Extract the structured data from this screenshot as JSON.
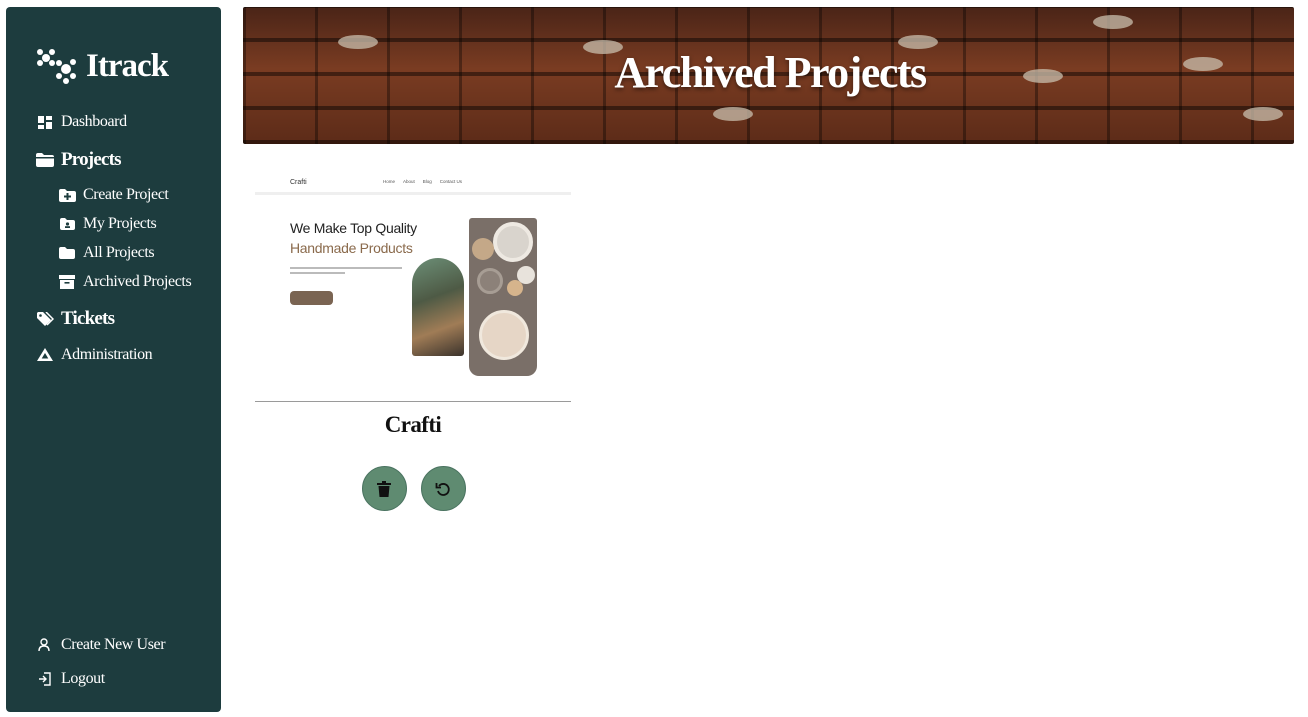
{
  "app": {
    "name": "Itrack"
  },
  "sidebar": {
    "items": [
      {
        "label": "Dashboard",
        "icon": "dashboard-icon"
      },
      {
        "label": "Projects",
        "icon": "folder-open-icon"
      },
      {
        "label": "Create Project",
        "icon": "folder-plus-icon"
      },
      {
        "label": "My Projects",
        "icon": "folder-user-icon"
      },
      {
        "label": "All Projects",
        "icon": "folder-icon"
      },
      {
        "label": "Archived Projects",
        "icon": "archive-icon"
      },
      {
        "label": "Tickets",
        "icon": "tags-icon"
      },
      {
        "label": "Administration",
        "icon": "drive-icon"
      }
    ],
    "bottom": [
      {
        "label": "Create New User",
        "icon": "user-icon"
      },
      {
        "label": "Logout",
        "icon": "logout-icon"
      }
    ]
  },
  "banner": {
    "title": "Archived Projects"
  },
  "projects": [
    {
      "name": "Crafti",
      "preview": {
        "brand": "Crafti",
        "links": [
          "Home",
          "About",
          "Blog",
          "Contact Us"
        ],
        "headline_1": "We Make Top Quality",
        "headline_2": "Handmade Products"
      },
      "actions": {
        "delete_icon": "trash-icon",
        "restore_icon": "restore-icon"
      }
    }
  ],
  "colors": {
    "sidebar_bg": "#1d3c3e",
    "action_button": "#5f8b71",
    "accent_brown": "#8a6a4c"
  }
}
